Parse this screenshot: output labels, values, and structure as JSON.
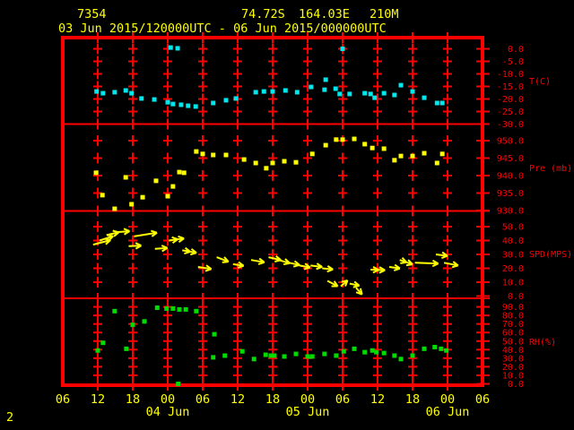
{
  "header": {
    "station_id": "7354",
    "latitude": "74.72S",
    "longitude": "164.03E",
    "elevation": "210M",
    "period": "03 Jun 2015/120000UTC - 06 Jun 2015/000000UTC"
  },
  "footer": {
    "page_number": "2"
  },
  "colors": {
    "background": "#000000",
    "axis": "#ff0000",
    "labels_yellow": "#ffff00",
    "temperature": "#00e8ee",
    "pressure": "#ffff00",
    "wind": "#ffff00",
    "humidity": "#00dc00"
  },
  "chart_data": {
    "type": "scatter",
    "title": "",
    "x_axis": {
      "hours_span": 72,
      "tick_interval_hours": 6,
      "tick_labels": [
        "06",
        "12",
        "18",
        "00",
        "06",
        "12",
        "18",
        "00",
        "06",
        "12",
        "18",
        "00",
        "06"
      ],
      "date_labels": [
        {
          "label": "04 Jun",
          "tick_index": 3
        },
        {
          "label": "05 Jun",
          "tick_index": 7
        },
        {
          "label": "06 Jun",
          "tick_index": 11
        }
      ]
    },
    "panels": [
      {
        "id": "temperature",
        "unit_label": "T(C)",
        "marker": "square",
        "tick_labels": [
          "0.0",
          "-5.0",
          "-10.0",
          "-15.0",
          "-20.0",
          "-25.0",
          "-30.0"
        ],
        "tick_values": [
          0,
          -5,
          -10,
          -15,
          -20,
          -25,
          -30
        ],
        "grid_tick_values": [
          0,
          -5,
          -10,
          -15,
          -20,
          -25
        ],
        "points": [
          [
            5.8,
            -17.0
          ],
          [
            6.9,
            -17.7
          ],
          [
            8.9,
            -17.3
          ],
          [
            10.8,
            -16.6
          ],
          [
            11.8,
            -17.7
          ],
          [
            13.5,
            -19.8
          ],
          [
            15.7,
            -20.2
          ],
          [
            18.0,
            -21.3
          ],
          [
            18.5,
            0.5
          ],
          [
            18.9,
            -22.0
          ],
          [
            19.7,
            0.2
          ],
          [
            20.3,
            -22.3
          ],
          [
            21.5,
            -22.7
          ],
          [
            22.8,
            -23.0
          ],
          [
            25.8,
            -21.6
          ],
          [
            28.0,
            -20.5
          ],
          [
            29.7,
            -19.8
          ],
          [
            33.1,
            -17.3
          ],
          [
            34.5,
            -17.0
          ],
          [
            36.0,
            -17.0
          ],
          [
            38.2,
            -16.6
          ],
          [
            40.2,
            -17.3
          ],
          [
            42.6,
            -15.2
          ],
          [
            44.9,
            -16.3
          ],
          [
            45.1,
            -12.3
          ],
          [
            46.8,
            -15.9
          ],
          [
            47.5,
            -18.0
          ],
          [
            48.0,
            0.0
          ],
          [
            49.2,
            -18.0
          ],
          [
            51.8,
            -17.7
          ],
          [
            52.8,
            -18.0
          ],
          [
            53.5,
            -19.5
          ],
          [
            55.1,
            -17.7
          ],
          [
            56.9,
            -18.4
          ],
          [
            58.0,
            -14.5
          ],
          [
            60.0,
            -17.0
          ],
          [
            62.0,
            -19.5
          ],
          [
            64.2,
            -21.6
          ],
          [
            65.1,
            -21.6
          ]
        ]
      },
      {
        "id": "pressure",
        "unit_label": "Pre (mb)",
        "marker": "square",
        "tick_labels": [
          "950.0",
          "945.0",
          "940.0",
          "935.0",
          "930.0"
        ],
        "tick_values": [
          950,
          945,
          940,
          935,
          930
        ],
        "grid_tick_values": [
          950,
          945,
          940,
          935
        ],
        "points": [
          [
            5.7,
            940.8
          ],
          [
            6.8,
            934.4
          ],
          [
            8.9,
            930.5
          ],
          [
            10.8,
            939.5
          ],
          [
            11.8,
            931.8
          ],
          [
            13.7,
            933.8
          ],
          [
            16.0,
            938.5
          ],
          [
            18.0,
            934.1
          ],
          [
            18.9,
            936.9
          ],
          [
            20.0,
            941.0
          ],
          [
            20.8,
            940.8
          ],
          [
            22.9,
            946.9
          ],
          [
            24.0,
            946.2
          ],
          [
            25.8,
            945.9
          ],
          [
            28.0,
            945.9
          ],
          [
            31.1,
            944.6
          ],
          [
            33.1,
            943.6
          ],
          [
            34.9,
            942.1
          ],
          [
            36.0,
            943.6
          ],
          [
            38.0,
            944.1
          ],
          [
            40.0,
            943.8
          ],
          [
            42.8,
            946.2
          ],
          [
            45.1,
            948.7
          ],
          [
            46.9,
            950.3
          ],
          [
            48.0,
            950.3
          ],
          [
            50.0,
            950.5
          ],
          [
            51.8,
            949.0
          ],
          [
            53.1,
            947.9
          ],
          [
            55.1,
            947.7
          ],
          [
            56.9,
            944.4
          ],
          [
            58.0,
            945.6
          ],
          [
            60.0,
            945.6
          ],
          [
            62.0,
            946.4
          ],
          [
            64.2,
            943.6
          ],
          [
            65.1,
            946.2
          ]
        ]
      },
      {
        "id": "wind_speed",
        "unit_label": "SPD(MPS)",
        "marker": "arrow",
        "tick_labels": [
          "50.0",
          "40.0",
          "30.0",
          "20.0",
          "10.0",
          "0.0"
        ],
        "tick_values": [
          50,
          40,
          30,
          20,
          10,
          0
        ],
        "grid_tick_values": [
          50,
          40,
          30,
          20,
          10
        ],
        "arrows": [
          [
            5.2,
            37,
            -15,
            20,
            1
          ],
          [
            6.3,
            40,
            -18,
            16,
            1
          ],
          [
            7.5,
            44,
            -12,
            14,
            1
          ],
          [
            9.0,
            46,
            -4,
            16,
            1
          ],
          [
            11.3,
            36,
            -2,
            14,
            1
          ],
          [
            12.2,
            43,
            -9,
            26,
            1
          ],
          [
            15.8,
            34,
            -4,
            14,
            1
          ],
          [
            18.2,
            40,
            -8,
            17,
            2
          ],
          [
            20.5,
            33,
            10,
            16,
            2
          ],
          [
            23.2,
            21,
            9,
            15,
            1
          ],
          [
            26.4,
            28,
            21,
            14,
            1
          ],
          [
            29.2,
            23,
            9,
            12,
            1
          ],
          [
            32.3,
            26,
            10,
            15,
            1
          ],
          [
            35.3,
            28,
            13,
            14,
            1
          ],
          [
            37.0,
            26,
            16,
            13,
            1
          ],
          [
            38.8,
            24,
            12,
            12,
            1
          ],
          [
            40.6,
            22,
            10,
            12,
            1
          ],
          [
            42.5,
            22,
            7,
            13,
            1
          ],
          [
            44.5,
            20,
            6,
            12,
            1
          ],
          [
            45.4,
            11,
            28,
            13,
            1
          ],
          [
            47.7,
            7,
            -42,
            10,
            1
          ],
          [
            49.2,
            9,
            12,
            11,
            1
          ],
          [
            50.3,
            6,
            48,
            10,
            1
          ],
          [
            52.8,
            19,
            2,
            16,
            2
          ],
          [
            56.0,
            21,
            8,
            12,
            1
          ],
          [
            57.8,
            26,
            19,
            15,
            2
          ],
          [
            60.4,
            24,
            2,
            26,
            1
          ],
          [
            64.0,
            30,
            7,
            13,
            1
          ],
          [
            65.4,
            24,
            11,
            16,
            1
          ]
        ]
      },
      {
        "id": "relative_humidity",
        "unit_label": "RH(%)",
        "marker": "square",
        "tick_labels": [
          "90.0",
          "80.0",
          "70.0",
          "60.0",
          "50.0",
          "40.0",
          "30.0",
          "20.0",
          "10.0",
          "0.0"
        ],
        "tick_values": [
          90,
          80,
          70,
          60,
          50,
          40,
          30,
          20,
          10,
          0
        ],
        "grid_tick_values": [
          90,
          80,
          70,
          60,
          50,
          40,
          30,
          20,
          10
        ],
        "points": [
          [
            6.0,
            39
          ],
          [
            6.9,
            48
          ],
          [
            8.9,
            85
          ],
          [
            10.9,
            41
          ],
          [
            12.0,
            69
          ],
          [
            14.0,
            73
          ],
          [
            16.2,
            89
          ],
          [
            17.8,
            88
          ],
          [
            18.9,
            88
          ],
          [
            19.8,
            0
          ],
          [
            20.0,
            87
          ],
          [
            21.1,
            87
          ],
          [
            22.9,
            85
          ],
          [
            25.8,
            31
          ],
          [
            26.0,
            58
          ],
          [
            27.8,
            33
          ],
          [
            30.8,
            38
          ],
          [
            32.8,
            29
          ],
          [
            34.8,
            34
          ],
          [
            35.7,
            33
          ],
          [
            36.3,
            33
          ],
          [
            38.0,
            32
          ],
          [
            40.0,
            35
          ],
          [
            42.0,
            32
          ],
          [
            42.8,
            32
          ],
          [
            44.9,
            35
          ],
          [
            46.9,
            33
          ],
          [
            48.2,
            38
          ],
          [
            50.0,
            41
          ],
          [
            51.8,
            37
          ],
          [
            53.1,
            39
          ],
          [
            53.8,
            37
          ],
          [
            55.1,
            36
          ],
          [
            56.9,
            33
          ],
          [
            58.0,
            29
          ],
          [
            60.0,
            33
          ],
          [
            62.0,
            41
          ],
          [
            63.8,
            43
          ],
          [
            64.9,
            41
          ],
          [
            65.8,
            39
          ]
        ]
      }
    ]
  }
}
